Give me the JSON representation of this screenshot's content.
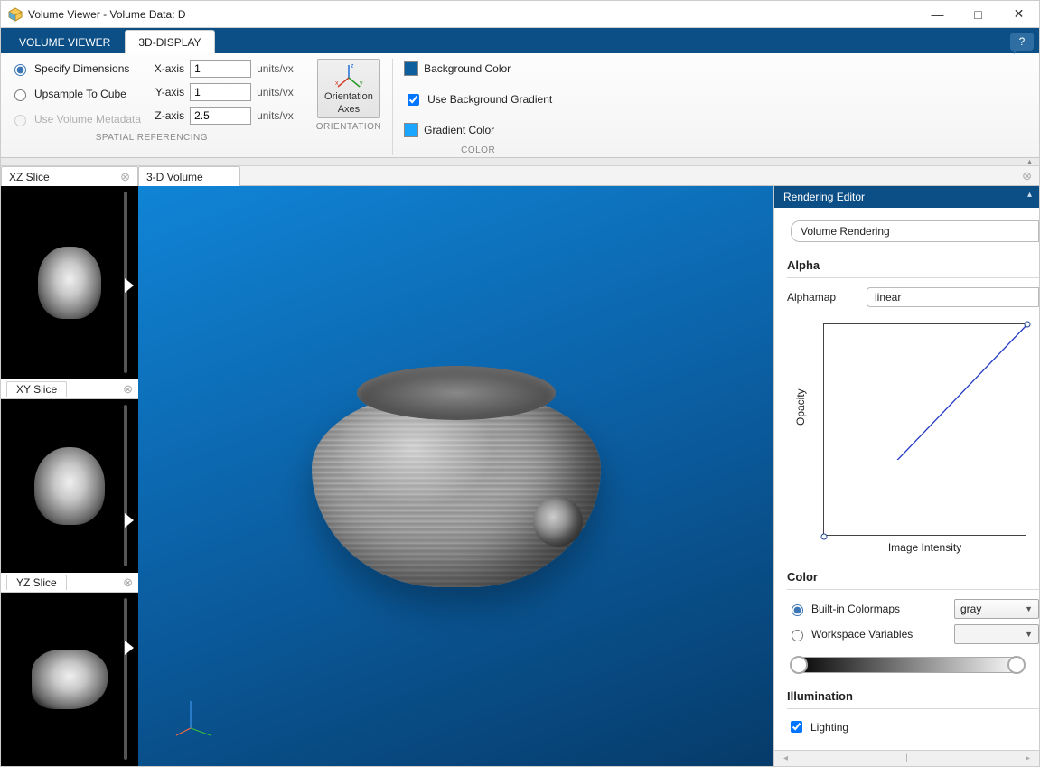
{
  "window": {
    "title": "Volume Viewer - Volume Data: D"
  },
  "tabs": {
    "volume_viewer": "VOLUME VIEWER",
    "display3d": "3D-DISPLAY"
  },
  "ribbon": {
    "spatial": {
      "specify_dims": "Specify Dimensions",
      "upsample": "Upsample To Cube",
      "use_meta": "Use Volume Metadata",
      "xaxis_label": "X-axis",
      "xaxis_value": "1",
      "yaxis_label": "Y-axis",
      "yaxis_value": "1",
      "zaxis_label": "Z-axis",
      "zaxis_value": "2.5",
      "units": "units/vx",
      "group_label": "SPATIAL REFERENCING"
    },
    "orientation": {
      "btn_line1": "Orientation",
      "btn_line2": "Axes",
      "group_label": "ORIENTATION"
    },
    "color": {
      "bg_label": "Background Color",
      "use_grad_label": "Use Background Gradient",
      "grad_label": "Gradient Color",
      "group_label": "COLOR",
      "bg_swatch": "#0e5f9e",
      "grad_swatch": "#1aa6ff"
    }
  },
  "slices": {
    "xz": "XZ Slice",
    "xy": "XY Slice",
    "yz": "YZ Slice",
    "vol3d": "3-D Volume"
  },
  "editor": {
    "title": "Rendering Editor",
    "render_mode": "Volume Rendering",
    "alpha_title": "Alpha",
    "alphamap_label": "Alphamap",
    "alphamap_value": "linear",
    "ylabel": "Opacity",
    "xlabel": "Image Intensity",
    "color_title": "Color",
    "builtin_label": "Built-in Colormaps",
    "builtin_value": "gray",
    "wsvar_label": "Workspace Variables",
    "illum_title": "Illumination",
    "lighting_label": "Lighting"
  },
  "chart_data": {
    "type": "line",
    "title": "",
    "xlabel": "Image Intensity",
    "ylabel": "Opacity",
    "xlim": [
      0,
      1
    ],
    "ylim": [
      0,
      1
    ],
    "series": [
      {
        "name": "alphamap",
        "x": [
          0,
          1
        ],
        "y": [
          0,
          1
        ]
      }
    ],
    "control_points": [
      {
        "x": 0,
        "y": 0
      },
      {
        "x": 1,
        "y": 1
      }
    ]
  }
}
